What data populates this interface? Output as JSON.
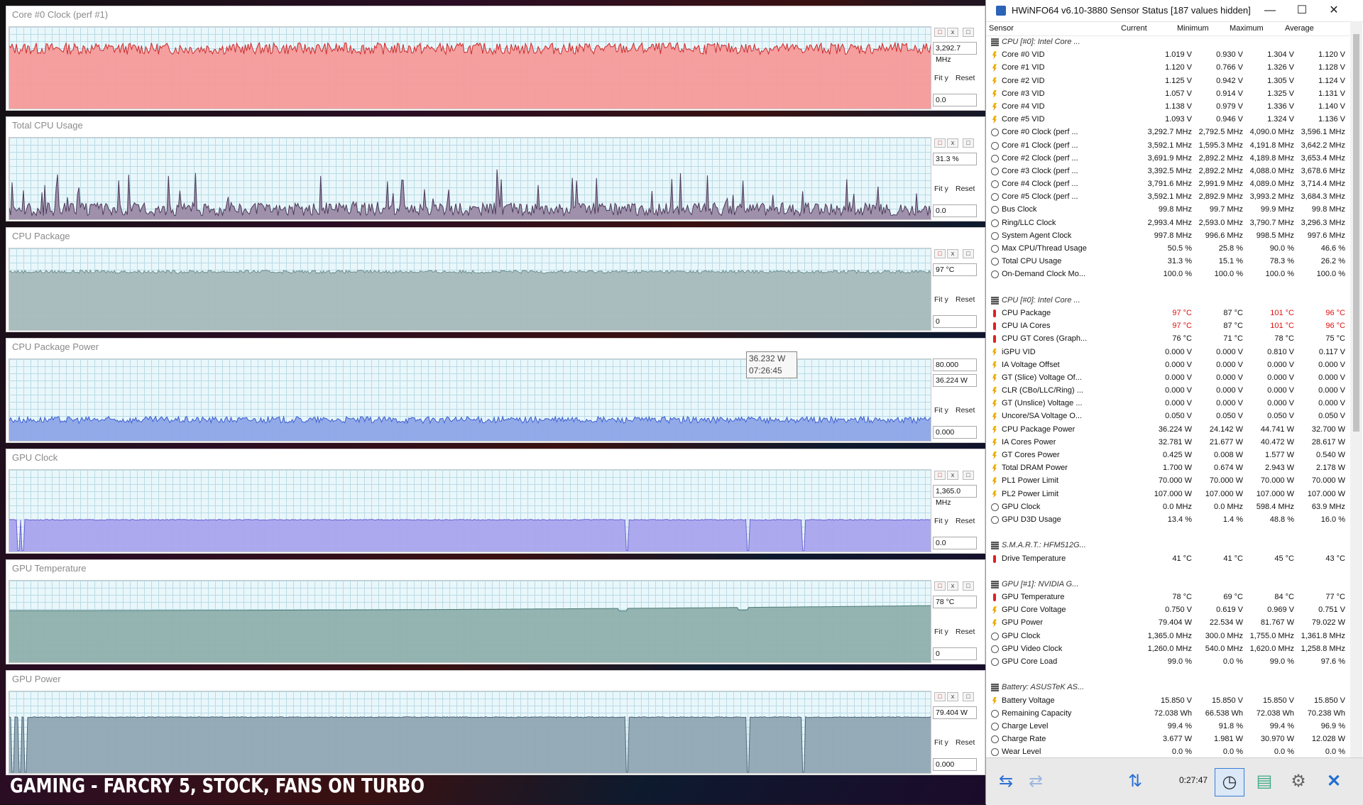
{
  "graphs": [
    {
      "title": "Core #0 Clock (perf #1)",
      "top_value": "",
      "current_value": "3,292.7 MHz",
      "min_value": "0.0",
      "fill": "#f59a9a",
      "line": "#cc2b2b",
      "level": 0.74,
      "noise": 0.07,
      "spikes": 0,
      "dips": []
    },
    {
      "title": "Total CPU Usage",
      "top_value": "",
      "current_value": "31.3 %",
      "min_value": "0.0",
      "fill": "#9b8aa7",
      "line": "#4b3a59",
      "level": 0.14,
      "noise": 0.08,
      "spikes": 1,
      "dips": []
    },
    {
      "title": "CPU Package",
      "top_value": "",
      "current_value": "97 °C",
      "min_value": "0",
      "fill": "#a7b9bb",
      "line": "#6f8f8e",
      "level": 0.72,
      "noise": 0.02,
      "spikes": 0,
      "dips": []
    },
    {
      "title": "CPU Package Power",
      "top_value": "80.000",
      "current_value": "36.224 W",
      "min_value": "0.000",
      "fill": "#8ea5e8",
      "line": "#3d5fcf",
      "level": 0.27,
      "noise": 0.04,
      "spikes": 0,
      "dips": []
    },
    {
      "title": "GPU Clock",
      "top_value": "",
      "current_value": "1,365.0 MHz",
      "min_value": "0.0",
      "fill": "#a9a4ee",
      "line": "#6c60d2",
      "level": 0.4,
      "noise": 0.005,
      "spikes": 0,
      "dips": [
        0.01,
        0.015,
        0.67,
        0.8,
        0.86
      ]
    },
    {
      "title": "GPU Temperature",
      "top_value": "",
      "current_value": "78 °C",
      "min_value": "0",
      "fill": "#8fb0ad",
      "line": "#4f7c78",
      "level": 0.64,
      "noise": 0.004,
      "spikes": 0,
      "dips": []
    },
    {
      "title": "GPU Power",
      "top_value": "",
      "current_value": "79.404 W",
      "min_value": "0.000",
      "fill": "#91a7b4",
      "line": "#4c6577",
      "level": 0.69,
      "noise": 0.005,
      "spikes": 0,
      "dips": [
        0.004,
        0.012,
        0.018,
        0.67,
        0.8,
        0.86
      ]
    }
  ],
  "graph_buttons": {
    "fit": "Fit y",
    "reset": "Reset",
    "close": "x",
    "minimize": "-",
    "square": "□"
  },
  "tooltip": {
    "value": "36.232 W",
    "time": "07:26:45"
  },
  "caption": "GAMING - FARCRY 5, STOCK, FANS ON TURBO",
  "hwinfo": {
    "title": "HWiNFO64 v6.10-3880 Sensor Status [187 values hidden]",
    "window_controls": {
      "minimize": "—",
      "maximize": "☐",
      "close": "✕"
    },
    "columns": [
      "Sensor",
      "Current",
      "Minimum",
      "Maximum",
      "Average"
    ],
    "rows": [
      {
        "type": "group",
        "name": "CPU [#0]: Intel Core ..."
      },
      {
        "type": "volt",
        "name": "Core #0 VID",
        "cur": "1.019 V",
        "min": "0.930 V",
        "max": "1.304 V",
        "avg": "1.120 V"
      },
      {
        "type": "volt",
        "name": "Core #1 VID",
        "cur": "1.120 V",
        "min": "0.766 V",
        "max": "1.326 V",
        "avg": "1.128 V"
      },
      {
        "type": "volt",
        "name": "Core #2 VID",
        "cur": "1.125 V",
        "min": "0.942 V",
        "max": "1.305 V",
        "avg": "1.124 V"
      },
      {
        "type": "volt",
        "name": "Core #3 VID",
        "cur": "1.057 V",
        "min": "0.914 V",
        "max": "1.325 V",
        "avg": "1.131 V"
      },
      {
        "type": "volt",
        "name": "Core #4 VID",
        "cur": "1.138 V",
        "min": "0.979 V",
        "max": "1.336 V",
        "avg": "1.140 V"
      },
      {
        "type": "volt",
        "name": "Core #5 VID",
        "cur": "1.093 V",
        "min": "0.946 V",
        "max": "1.324 V",
        "avg": "1.136 V"
      },
      {
        "type": "clock",
        "name": "Core #0 Clock (perf ...",
        "cur": "3,292.7 MHz",
        "min": "2,792.5 MHz",
        "max": "4,090.0 MHz",
        "avg": "3,596.1 MHz"
      },
      {
        "type": "clock",
        "name": "Core #1 Clock (perf ...",
        "cur": "3,592.1 MHz",
        "min": "1,595.3 MHz",
        "max": "4,191.8 MHz",
        "avg": "3,642.2 MHz"
      },
      {
        "type": "clock",
        "name": "Core #2 Clock (perf ...",
        "cur": "3,691.9 MHz",
        "min": "2,892.2 MHz",
        "max": "4,189.8 MHz",
        "avg": "3,653.4 MHz"
      },
      {
        "type": "clock",
        "name": "Core #3 Clock (perf ...",
        "cur": "3,392.5 MHz",
        "min": "2,892.2 MHz",
        "max": "4,088.0 MHz",
        "avg": "3,678.6 MHz"
      },
      {
        "type": "clock",
        "name": "Core #4 Clock (perf ...",
        "cur": "3,791.6 MHz",
        "min": "2,991.9 MHz",
        "max": "4,089.0 MHz",
        "avg": "3,714.4 MHz"
      },
      {
        "type": "clock",
        "name": "Core #5 Clock (perf ...",
        "cur": "3,592.1 MHz",
        "min": "2,892.9 MHz",
        "max": "3,993.2 MHz",
        "avg": "3,684.3 MHz"
      },
      {
        "type": "clock",
        "name": "Bus Clock",
        "cur": "99.8 MHz",
        "min": "99.7 MHz",
        "max": "99.9 MHz",
        "avg": "99.8 MHz"
      },
      {
        "type": "clock",
        "name": "Ring/LLC Clock",
        "cur": "2,993.4 MHz",
        "min": "2,593.0 MHz",
        "max": "3,790.7 MHz",
        "avg": "3,296.3 MHz"
      },
      {
        "type": "clock",
        "name": "System Agent Clock",
        "cur": "997.8 MHz",
        "min": "996.6 MHz",
        "max": "998.5 MHz",
        "avg": "997.6 MHz"
      },
      {
        "type": "clock",
        "name": "Max CPU/Thread Usage",
        "cur": "50.5 %",
        "min": "25.8 %",
        "max": "90.0 %",
        "avg": "46.6 %"
      },
      {
        "type": "clock",
        "name": "Total CPU Usage",
        "cur": "31.3 %",
        "min": "15.1 %",
        "max": "78.3 %",
        "avg": "26.2 %"
      },
      {
        "type": "clock",
        "name": "On-Demand Clock Mo...",
        "cur": "100.0 %",
        "min": "100.0 %",
        "max": "100.0 %",
        "avg": "100.0 %"
      },
      {
        "type": "blank"
      },
      {
        "type": "group",
        "name": "CPU [#0]: Intel Core ..."
      },
      {
        "type": "temp",
        "name": "CPU Package",
        "cur": "97 °C",
        "min": "87 °C",
        "max": "101 °C",
        "avg": "96 °C",
        "hot": true
      },
      {
        "type": "temp",
        "name": "CPU IA Cores",
        "cur": "97 °C",
        "min": "87 °C",
        "max": "101 °C",
        "avg": "96 °C",
        "hot": true
      },
      {
        "type": "temp",
        "name": "CPU GT Cores (Graph...",
        "cur": "76 °C",
        "min": "71 °C",
        "max": "78 °C",
        "avg": "75 °C"
      },
      {
        "type": "volt",
        "name": "iGPU VID",
        "cur": "0.000 V",
        "min": "0.000 V",
        "max": "0.810 V",
        "avg": "0.117 V"
      },
      {
        "type": "volt",
        "name": "IA Voltage Offset",
        "cur": "0.000 V",
        "min": "0.000 V",
        "max": "0.000 V",
        "avg": "0.000 V"
      },
      {
        "type": "volt",
        "name": "GT (Slice) Voltage Of...",
        "cur": "0.000 V",
        "min": "0.000 V",
        "max": "0.000 V",
        "avg": "0.000 V"
      },
      {
        "type": "volt",
        "name": "CLR (CBo/LLC/Ring) ...",
        "cur": "0.000 V",
        "min": "0.000 V",
        "max": "0.000 V",
        "avg": "0.000 V"
      },
      {
        "type": "volt",
        "name": "GT (Unslice) Voltage ...",
        "cur": "0.000 V",
        "min": "0.000 V",
        "max": "0.000 V",
        "avg": "0.000 V"
      },
      {
        "type": "volt",
        "name": "Uncore/SA Voltage O...",
        "cur": "0.050 V",
        "min": "0.050 V",
        "max": "0.050 V",
        "avg": "0.050 V"
      },
      {
        "type": "volt",
        "name": "CPU Package Power",
        "cur": "36.224 W",
        "min": "24.142 W",
        "max": "44.741 W",
        "avg": "32.700 W"
      },
      {
        "type": "volt",
        "name": "IA Cores Power",
        "cur": "32.781 W",
        "min": "21.677 W",
        "max": "40.472 W",
        "avg": "28.617 W"
      },
      {
        "type": "volt",
        "name": "GT Cores Power",
        "cur": "0.425 W",
        "min": "0.008 W",
        "max": "1.577 W",
        "avg": "0.540 W"
      },
      {
        "type": "volt",
        "name": "Total DRAM Power",
        "cur": "1.700 W",
        "min": "0.674 W",
        "max": "2.943 W",
        "avg": "2.178 W"
      },
      {
        "type": "volt",
        "name": "PL1 Power Limit",
        "cur": "70.000 W",
        "min": "70.000 W",
        "max": "70.000 W",
        "avg": "70.000 W"
      },
      {
        "type": "volt",
        "name": "PL2 Power Limit",
        "cur": "107.000 W",
        "min": "107.000 W",
        "max": "107.000 W",
        "avg": "107.000 W"
      },
      {
        "type": "clock",
        "name": "GPU Clock",
        "cur": "0.0 MHz",
        "min": "0.0 MHz",
        "max": "598.4 MHz",
        "avg": "63.9 MHz"
      },
      {
        "type": "clock",
        "name": "GPU D3D Usage",
        "cur": "13.4 %",
        "min": "1.4 %",
        "max": "48.8 %",
        "avg": "16.0 %"
      },
      {
        "type": "blank"
      },
      {
        "type": "group",
        "name": "S.M.A.R.T.: HFM512G..."
      },
      {
        "type": "temp",
        "name": "Drive Temperature",
        "cur": "41 °C",
        "min": "41 °C",
        "max": "45 °C",
        "avg": "43 °C"
      },
      {
        "type": "blank"
      },
      {
        "type": "group",
        "name": "GPU [#1]: NVIDIA G..."
      },
      {
        "type": "temp",
        "name": "GPU Temperature",
        "cur": "78 °C",
        "min": "69 °C",
        "max": "84 °C",
        "avg": "77 °C"
      },
      {
        "type": "volt",
        "name": "GPU Core Voltage",
        "cur": "0.750 V",
        "min": "0.619 V",
        "max": "0.969 V",
        "avg": "0.751 V"
      },
      {
        "type": "volt",
        "name": "GPU Power",
        "cur": "79.404 W",
        "min": "22.534 W",
        "max": "81.767 W",
        "avg": "79.022 W"
      },
      {
        "type": "clock",
        "name": "GPU Clock",
        "cur": "1,365.0 MHz",
        "min": "300.0 MHz",
        "max": "1,755.0 MHz",
        "avg": "1,361.8 MHz"
      },
      {
        "type": "clock",
        "name": "GPU Video Clock",
        "cur": "1,260.0 MHz",
        "min": "540.0 MHz",
        "max": "1,620.0 MHz",
        "avg": "1,258.8 MHz"
      },
      {
        "type": "clock",
        "name": "GPU Core Load",
        "cur": "99.0 %",
        "min": "0.0 %",
        "max": "99.0 %",
        "avg": "97.6 %"
      },
      {
        "type": "blank"
      },
      {
        "type": "group",
        "name": "Battery: ASUSTeK AS..."
      },
      {
        "type": "volt",
        "name": "Battery Voltage",
        "cur": "15.850 V",
        "min": "15.850 V",
        "max": "15.850 V",
        "avg": "15.850 V"
      },
      {
        "type": "clock",
        "name": "Remaining Capacity",
        "cur": "72.038 Wh",
        "min": "66.538 Wh",
        "max": "72.038 Wh",
        "avg": "70.238 Wh"
      },
      {
        "type": "clock",
        "name": "Charge Level",
        "cur": "99.4 %",
        "min": "91.8 %",
        "max": "99.4 %",
        "avg": "96.9 %"
      },
      {
        "type": "clock",
        "name": "Charge Rate",
        "cur": "3.677 W",
        "min": "1.981 W",
        "max": "30.970 W",
        "avg": "12.028 W"
      },
      {
        "type": "clock",
        "name": "Wear Level",
        "cur": "0.0 %",
        "min": "0.0 %",
        "max": "0.0 %",
        "avg": "0.0 %"
      }
    ],
    "bottom": {
      "timer": "0:27:47",
      "nav_left": "⇆",
      "nav_right": "⇄",
      "network": "⇅",
      "clock": "◷",
      "report": "▤",
      "settings": "⚙",
      "close": "✕"
    },
    "colors": {
      "hot": "#e01010",
      "close_button": "#1f6fd1"
    }
  }
}
